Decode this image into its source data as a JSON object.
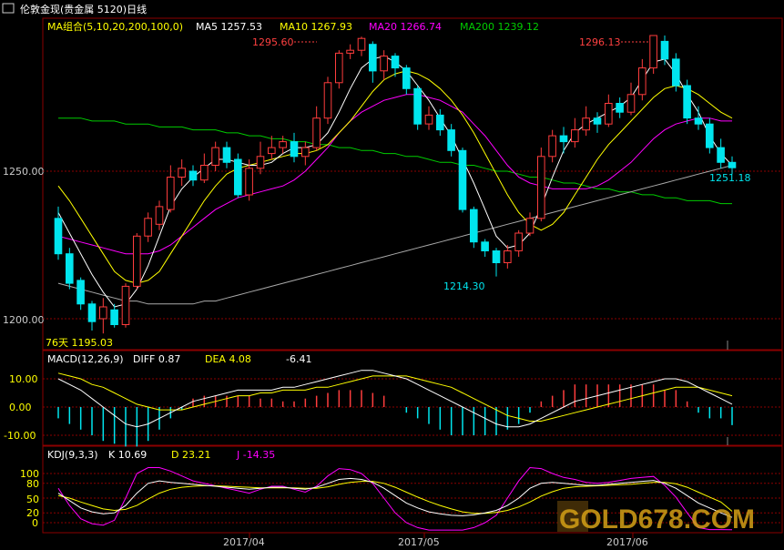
{
  "title": "伦敦金现(贵金属 5120)日线",
  "colors": {
    "up": "#ff3d3d",
    "down": "#00e5ee",
    "ma5": "#ffffff",
    "ma10": "#ffff00",
    "ma20": "#ff00ff",
    "ma200": "#00cc00",
    "ma100": "#aaaaaa",
    "dotline": "#8b0000",
    "kdj_k": "#ffffff",
    "kdj_d": "#ffff00",
    "kdj_j": "#ff00ff",
    "dif": "#ffffff",
    "dea": "#ffff00",
    "logo": "#d4a017"
  },
  "price_panel": {
    "legend": {
      "label": "MA组合(5,10,20,200,100,0)",
      "ma5": "MA5 1257.53",
      "ma10": "MA10 1267.93",
      "ma20": "MA20 1266.74",
      "ma200": "MA200 1239.12"
    },
    "y_ticks": [
      "1250.00",
      "1200.00"
    ],
    "annotations": {
      "high1": "1295.60",
      "high2": "1296.13",
      "low1": "1214.30",
      "last": "1251.18",
      "left_low": "76天 1195.03"
    }
  },
  "macd_panel": {
    "label": "MACD(12,26,9)",
    "diff": "DIFF  0.87",
    "dea": "DEA  4.08",
    "macd": "-6.41",
    "y_ticks": [
      "10.00",
      "0.00",
      "-10.00"
    ]
  },
  "kdj_panel": {
    "label": "KDJ(9,3,3)",
    "k": "K  10.69",
    "d": "D  23.21",
    "j": "J  -14.35",
    "y_ticks": [
      "100",
      "80",
      "50",
      "20",
      "0"
    ]
  },
  "x_axis": [
    "2017/04",
    "2017/05",
    "2017/06"
  ],
  "watermark": "GOLD678.COM",
  "chart_data": {
    "type": "candlestick",
    "title": "伦敦金现(贵金属 5120)日线",
    "ylim": [
      1190,
      1300
    ],
    "y_ticks": [
      1200,
      1250
    ],
    "candles": [
      {
        "o": 1234,
        "c": 1222,
        "h": 1238,
        "l": 1220
      },
      {
        "o": 1222,
        "c": 1212,
        "h": 1224,
        "l": 1210
      },
      {
        "o": 1213,
        "c": 1205,
        "h": 1214,
        "l": 1203
      },
      {
        "o": 1205,
        "c": 1199,
        "h": 1206,
        "l": 1196
      },
      {
        "o": 1200,
        "c": 1204,
        "h": 1207,
        "l": 1195
      },
      {
        "o": 1203,
        "c": 1198,
        "h": 1205,
        "l": 1197
      },
      {
        "o": 1198,
        "c": 1211,
        "h": 1212,
        "l": 1197
      },
      {
        "o": 1211,
        "c": 1228,
        "h": 1229,
        "l": 1210
      },
      {
        "o": 1228,
        "c": 1234,
        "h": 1236,
        "l": 1226
      },
      {
        "o": 1232,
        "c": 1238,
        "h": 1240,
        "l": 1230
      },
      {
        "o": 1237,
        "c": 1248,
        "h": 1252,
        "l": 1236
      },
      {
        "o": 1248,
        "c": 1251,
        "h": 1254,
        "l": 1245
      },
      {
        "o": 1250,
        "c": 1247,
        "h": 1252,
        "l": 1245
      },
      {
        "o": 1247,
        "c": 1252,
        "h": 1256,
        "l": 1246
      },
      {
        "o": 1252,
        "c": 1258,
        "h": 1260,
        "l": 1250
      },
      {
        "o": 1258,
        "c": 1253,
        "h": 1260,
        "l": 1251
      },
      {
        "o": 1254,
        "c": 1242,
        "h": 1256,
        "l": 1241
      },
      {
        "o": 1242,
        "c": 1251,
        "h": 1254,
        "l": 1240
      },
      {
        "o": 1251,
        "c": 1255,
        "h": 1260,
        "l": 1249
      },
      {
        "o": 1256,
        "c": 1258,
        "h": 1262,
        "l": 1254
      },
      {
        "o": 1258,
        "c": 1260,
        "h": 1262,
        "l": 1256
      },
      {
        "o": 1260,
        "c": 1255,
        "h": 1263,
        "l": 1253
      },
      {
        "o": 1255,
        "c": 1258,
        "h": 1260,
        "l": 1252
      },
      {
        "o": 1258,
        "c": 1268,
        "h": 1272,
        "l": 1257
      },
      {
        "o": 1268,
        "c": 1280,
        "h": 1282,
        "l": 1266
      },
      {
        "o": 1280,
        "c": 1290,
        "h": 1291,
        "l": 1278
      },
      {
        "o": 1290,
        "c": 1291,
        "h": 1293,
        "l": 1288
      },
      {
        "o": 1291,
        "c": 1295,
        "h": 1295.6,
        "l": 1289
      },
      {
        "o": 1293,
        "c": 1284,
        "h": 1294,
        "l": 1280
      },
      {
        "o": 1284,
        "c": 1289,
        "h": 1291,
        "l": 1281
      },
      {
        "o": 1289,
        "c": 1285,
        "h": 1290,
        "l": 1282
      },
      {
        "o": 1285,
        "c": 1278,
        "h": 1286,
        "l": 1276
      },
      {
        "o": 1278,
        "c": 1266,
        "h": 1279,
        "l": 1264
      },
      {
        "o": 1266,
        "c": 1269,
        "h": 1272,
        "l": 1264
      },
      {
        "o": 1269,
        "c": 1264,
        "h": 1271,
        "l": 1262
      },
      {
        "o": 1264,
        "c": 1257,
        "h": 1266,
        "l": 1255
      },
      {
        "o": 1257,
        "c": 1237,
        "h": 1258,
        "l": 1236
      },
      {
        "o": 1237,
        "c": 1226,
        "h": 1238,
        "l": 1224
      },
      {
        "o": 1226,
        "c": 1223,
        "h": 1227,
        "l": 1221
      },
      {
        "o": 1223,
        "c": 1219,
        "h": 1224,
        "l": 1214.3
      },
      {
        "o": 1219,
        "c": 1223,
        "h": 1225,
        "l": 1217
      },
      {
        "o": 1223,
        "c": 1229,
        "h": 1230,
        "l": 1221
      },
      {
        "o": 1229,
        "c": 1234,
        "h": 1236,
        "l": 1228
      },
      {
        "o": 1234,
        "c": 1255,
        "h": 1258,
        "l": 1233
      },
      {
        "o": 1255,
        "c": 1262,
        "h": 1264,
        "l": 1253
      },
      {
        "o": 1262,
        "c": 1260,
        "h": 1265,
        "l": 1256
      },
      {
        "o": 1260,
        "c": 1264,
        "h": 1268,
        "l": 1258
      },
      {
        "o": 1264,
        "c": 1268,
        "h": 1272,
        "l": 1262
      },
      {
        "o": 1268,
        "c": 1266,
        "h": 1270,
        "l": 1263
      },
      {
        "o": 1266,
        "c": 1273,
        "h": 1276,
        "l": 1265
      },
      {
        "o": 1273,
        "c": 1270,
        "h": 1275,
        "l": 1268
      },
      {
        "o": 1270,
        "c": 1276,
        "h": 1280,
        "l": 1269
      },
      {
        "o": 1276,
        "c": 1285,
        "h": 1288,
        "l": 1274
      },
      {
        "o": 1285,
        "c": 1296,
        "h": 1296.13,
        "l": 1283
      },
      {
        "o": 1294,
        "c": 1288,
        "h": 1296,
        "l": 1286
      },
      {
        "o": 1288,
        "c": 1279,
        "h": 1290,
        "l": 1277
      },
      {
        "o": 1279,
        "c": 1268,
        "h": 1281,
        "l": 1266
      },
      {
        "o": 1268,
        "c": 1266,
        "h": 1272,
        "l": 1264
      },
      {
        "o": 1266,
        "c": 1258,
        "h": 1268,
        "l": 1256
      },
      {
        "o": 1258,
        "c": 1253,
        "h": 1261,
        "l": 1251
      },
      {
        "o": 1253,
        "c": 1251.18,
        "h": 1255,
        "l": 1249
      }
    ],
    "ma": {
      "ma5": [
        1236,
        1229,
        1222,
        1215,
        1209,
        1204,
        1205,
        1210,
        1218,
        1228,
        1238,
        1244,
        1248,
        1251,
        1254,
        1254,
        1253,
        1252,
        1252,
        1253,
        1256,
        1258,
        1258,
        1259,
        1263,
        1270,
        1278,
        1285,
        1288,
        1289,
        1287,
        1284,
        1279,
        1274,
        1268,
        1262,
        1254,
        1246,
        1237,
        1228,
        1224,
        1225,
        1229,
        1238,
        1248,
        1257,
        1263,
        1266,
        1268,
        1270,
        1272,
        1275,
        1281,
        1287,
        1288,
        1283,
        1276,
        1270,
        1262,
        1256,
        1252
      ],
      "ma10": [
        1245,
        1240,
        1234,
        1228,
        1222,
        1216,
        1213,
        1212,
        1213,
        1216,
        1222,
        1228,
        1234,
        1240,
        1245,
        1249,
        1251,
        1252,
        1253,
        1254,
        1255,
        1256,
        1256,
        1257,
        1259,
        1263,
        1267,
        1272,
        1277,
        1281,
        1283,
        1284,
        1283,
        1281,
        1278,
        1274,
        1269,
        1263,
        1256,
        1249,
        1242,
        1236,
        1232,
        1230,
        1232,
        1236,
        1242,
        1248,
        1254,
        1259,
        1263,
        1267,
        1271,
        1275,
        1278,
        1279,
        1278,
        1276,
        1273,
        1270,
        1268
      ],
      "ma20": [
        1228,
        1227,
        1226,
        1225,
        1224,
        1223,
        1222,
        1222,
        1222,
        1223,
        1225,
        1228,
        1231,
        1234,
        1237,
        1239,
        1241,
        1242,
        1243,
        1244,
        1245,
        1247,
        1250,
        1254,
        1258,
        1263,
        1267,
        1270,
        1272,
        1274,
        1275,
        1276,
        1276,
        1275,
        1274,
        1272,
        1270,
        1266,
        1262,
        1257,
        1252,
        1248,
        1246,
        1245,
        1244,
        1244,
        1244,
        1244,
        1245,
        1247,
        1250,
        1253,
        1257,
        1261,
        1264,
        1266,
        1267,
        1268,
        1268,
        1267,
        1267
      ],
      "ma100": [
        1212,
        1211,
        1210,
        1209,
        1208,
        1207,
        1206,
        1206,
        1205,
        1205,
        1205,
        1205,
        1205,
        1206,
        1206,
        1207,
        1208,
        1209,
        1210,
        1211,
        1212,
        1213,
        1214,
        1215,
        1216,
        1217,
        1218,
        1219,
        1220,
        1221,
        1222,
        1223,
        1224,
        1225,
        1226,
        1227,
        1228,
        1229,
        1230,
        1231,
        1232,
        1233,
        1234,
        1235,
        1236,
        1237,
        1238,
        1239,
        1240,
        1241,
        1242,
        1243,
        1244,
        1245,
        1246,
        1247,
        1248,
        1249,
        1250,
        1251,
        1252
      ],
      "ma200": [
        1268,
        1268,
        1268,
        1267,
        1267,
        1267,
        1266,
        1266,
        1266,
        1265,
        1265,
        1265,
        1264,
        1264,
        1264,
        1263,
        1263,
        1262,
        1262,
        1261,
        1261,
        1260,
        1260,
        1259,
        1259,
        1258,
        1258,
        1257,
        1257,
        1256,
        1256,
        1255,
        1255,
        1254,
        1253,
        1253,
        1252,
        1252,
        1251,
        1250,
        1250,
        1249,
        1248,
        1248,
        1247,
        1246,
        1246,
        1245,
        1244,
        1244,
        1243,
        1243,
        1242,
        1242,
        1241,
        1241,
        1240,
        1240,
        1240,
        1239,
        1239
      ]
    },
    "macd": {
      "ylim": [
        -14,
        14
      ],
      "dif": [
        10,
        8,
        6,
        3,
        0,
        -3,
        -6,
        -7,
        -6,
        -4,
        -2,
        0,
        2,
        3,
        4,
        5,
        6,
        6,
        6,
        6,
        7,
        7,
        8,
        9,
        10,
        11,
        12,
        13,
        13,
        12,
        11,
        10,
        8,
        6,
        4,
        2,
        0,
        -2,
        -4,
        -6,
        -7,
        -7,
        -6,
        -4,
        -2,
        0,
        2,
        3,
        4,
        5,
        6,
        7,
        8,
        9,
        10,
        10,
        9,
        7,
        5,
        3,
        1
      ],
      "dea": [
        12,
        11,
        10,
        8,
        7,
        5,
        3,
        1,
        0,
        -1,
        -1,
        -1,
        0,
        1,
        2,
        3,
        4,
        4,
        5,
        5,
        6,
        6,
        6,
        7,
        7,
        8,
        9,
        10,
        11,
        11,
        11,
        11,
        10,
        9,
        8,
        7,
        5,
        3,
        1,
        -1,
        -3,
        -4,
        -5,
        -5,
        -4,
        -3,
        -2,
        -1,
        0,
        1,
        2,
        3,
        4,
        5,
        6,
        7,
        7,
        7,
        6,
        5,
        4
      ],
      "hist": [
        -4,
        -6,
        -8,
        -10,
        -12,
        -13,
        -14,
        -14,
        -12,
        -8,
        -4,
        -1,
        3,
        4,
        4,
        4,
        4,
        4,
        3,
        3,
        2,
        2,
        3,
        4,
        5,
        6,
        6,
        6,
        5,
        4,
        0,
        -2,
        -4,
        -6,
        -8,
        -10,
        -10,
        -10,
        -10,
        -10,
        -8,
        -6,
        -2,
        2,
        4,
        6,
        8,
        8,
        8,
        8,
        8,
        8,
        8,
        8,
        6,
        6,
        2,
        -2,
        -4,
        -4,
        -6.41
      ]
    },
    "kdj": {
      "ylim": [
        -20,
        115
      ],
      "k": [
        60,
        45,
        30,
        22,
        18,
        20,
        35,
        60,
        80,
        85,
        82,
        80,
        78,
        76,
        74,
        72,
        70,
        68,
        70,
        72,
        72,
        70,
        68,
        72,
        80,
        88,
        90,
        88,
        82,
        70,
        55,
        40,
        30,
        22,
        18,
        15,
        14,
        16,
        20,
        25,
        35,
        50,
        70,
        80,
        82,
        80,
        78,
        76,
        76,
        78,
        80,
        82,
        84,
        86,
        80,
        70,
        55,
        40,
        30,
        20,
        10.69
      ],
      "d": [
        55,
        50,
        42,
        35,
        28,
        25,
        27,
        35,
        48,
        60,
        68,
        72,
        74,
        75,
        75,
        74,
        73,
        72,
        71,
        71,
        71,
        71,
        70,
        70,
        73,
        78,
        82,
        84,
        84,
        80,
        72,
        62,
        52,
        43,
        35,
        28,
        22,
        19,
        19,
        21,
        25,
        32,
        42,
        54,
        63,
        70,
        73,
        74,
        75,
        76,
        77,
        78,
        80,
        82,
        82,
        79,
        72,
        62,
        52,
        42,
        23.21
      ],
      "j": [
        70,
        35,
        8,
        -2,
        -5,
        5,
        50,
        100,
        115,
        115,
        105,
        95,
        85,
        80,
        75,
        70,
        65,
        60,
        68,
        74,
        74,
        68,
        62,
        74,
        95,
        110,
        108,
        100,
        80,
        50,
        20,
        0,
        -10,
        -15,
        -15,
        -15,
        -15,
        -10,
        0,
        15,
        50,
        85,
        115,
        110,
        100,
        92,
        88,
        82,
        80,
        82,
        86,
        90,
        92,
        94,
        76,
        52,
        20,
        -10,
        -14,
        -14,
        -14.35
      ]
    }
  }
}
